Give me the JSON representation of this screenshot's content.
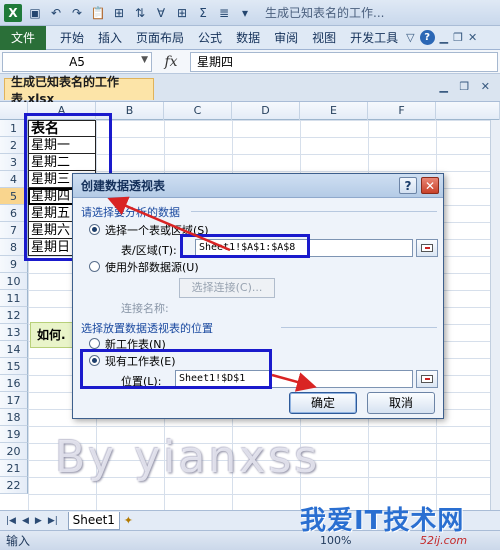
{
  "titlebar": {
    "title": "生成已知表名的工作...",
    "logo": "X"
  },
  "ribbon": {
    "file_tab": "文件",
    "tabs": [
      "开始",
      "插入",
      "页面布局",
      "公式",
      "数据",
      "审阅",
      "视图",
      "开发工具"
    ]
  },
  "formula_bar": {
    "name_box": "A5",
    "fx": "fx",
    "value": "星期四"
  },
  "workbook": {
    "tab_title": "生成已知表名的工作表.xlsx"
  },
  "grid": {
    "columns": [
      "A",
      "B",
      "C",
      "D",
      "E",
      "F"
    ],
    "rows": [
      "1",
      "2",
      "3",
      "4",
      "5",
      "6",
      "7",
      "8",
      "9",
      "10",
      "11",
      "12",
      "13",
      "14",
      "15",
      "16",
      "17",
      "18",
      "19",
      "20",
      "21",
      "22"
    ],
    "active_row": "5",
    "cells_a": [
      "表名",
      "星期一",
      "星期二",
      "星期三",
      "星期四",
      "星期五",
      "星期六",
      "星期日"
    ]
  },
  "howto_note": "如何.",
  "watermark": "By yianxss",
  "sheet_tabs": {
    "sheet": "Sheet1"
  },
  "status": {
    "mode": "输入",
    "zoom": "100%"
  },
  "brand": {
    "name": "我爱IT技术网",
    "url": "52ij.com"
  },
  "dialog": {
    "title": "创建数据透视表",
    "section_analyze": "请选择要分析的数据",
    "opt_range": "选择一个表或区域(S)",
    "range_label": "表/区域(T):",
    "range_value": "Sheet1!$A$1:$A$8",
    "opt_external": "使用外部数据源(U)",
    "choose_conn": "选择连接(C)...",
    "conn_name": "连接名称:",
    "section_place": "选择放置数据透视表的位置",
    "opt_new_sheet": "新工作表(N)",
    "opt_existing": "现有工作表(E)",
    "location_label": "位置(L):",
    "location_value": "Sheet1!$D$1",
    "ok": "确定",
    "cancel": "取消"
  },
  "colors": {
    "highlight": "#1a1acc",
    "arrow": "#d92424",
    "file_tab": "#2a6f38",
    "dialog_title": "#14305a"
  }
}
